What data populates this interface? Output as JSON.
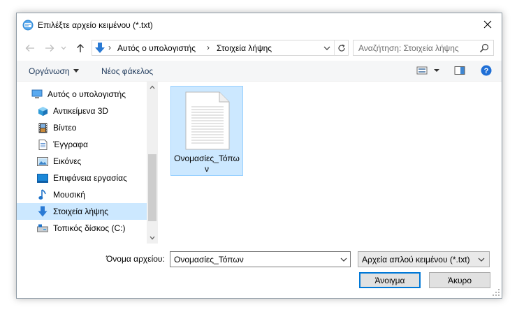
{
  "window": {
    "title": "Επιλέξτε αρχείο κειμένου (*.txt)"
  },
  "address": {
    "segments": [
      "Αυτός ο υπολογιστής",
      "Στοιχεία λήψης"
    ],
    "separator": "›"
  },
  "search": {
    "placeholder": "Αναζήτηση: Στοιχεία λήψης"
  },
  "toolbar": {
    "organize_label": "Οργάνωση",
    "new_folder_label": "Νέος φάκελος"
  },
  "navigation": {
    "items": [
      {
        "label": "Αυτός ο υπολογιστής",
        "icon": "computer-icon",
        "selected": false
      },
      {
        "label": "Αντικείμενα 3D",
        "icon": "cube-3d-icon",
        "selected": false
      },
      {
        "label": "Βίντεο",
        "icon": "film-icon",
        "selected": false
      },
      {
        "label": "Έγγραφα",
        "icon": "document-icon",
        "selected": false
      },
      {
        "label": "Εικόνες",
        "icon": "picture-icon",
        "selected": false
      },
      {
        "label": "Επιφάνεια εργασίας",
        "icon": "desktop-icon",
        "selected": false
      },
      {
        "label": "Μουσική",
        "icon": "music-note-icon",
        "selected": false
      },
      {
        "label": "Στοιχεία λήψης",
        "icon": "download-arrow-icon",
        "selected": true
      },
      {
        "label": "Τοπικός δίσκος (C:)",
        "icon": "drive-icon",
        "selected": false
      }
    ]
  },
  "files": [
    {
      "name": "Ονομασίες_Τόπων",
      "icon": "text-file-icon",
      "selected": true
    }
  ],
  "footer": {
    "filename_label": "Όνομα αρχείου:",
    "filename_value": "Ονομασίες_Τόπων",
    "filter_value": "Αρχεία απλού κειμένου (*.txt)",
    "open_label": "Άνοιγμα",
    "cancel_label": "Άκυρο"
  },
  "colors": {
    "accent": "#0078d7",
    "selection_fill": "#cce8ff",
    "selection_border": "#99d1ff",
    "toolbar_text": "#1e395b",
    "help_blue": "#1f6fd6"
  }
}
